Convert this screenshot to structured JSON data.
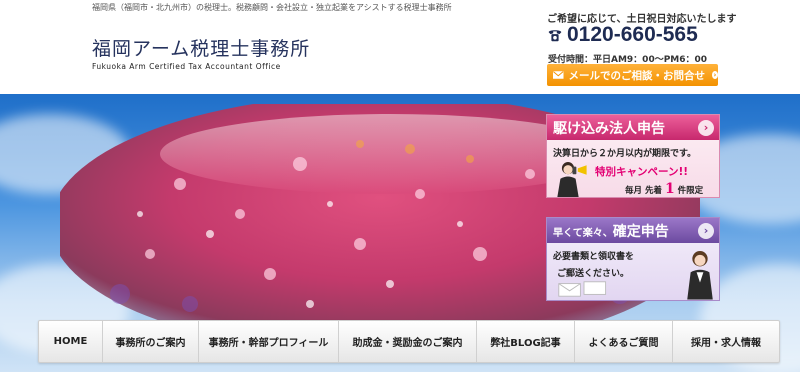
{
  "header": {
    "tagline": "福岡県（福岡市・北九州市）の税理士。税務顧問・会社設立・独立起業をアシストする税理士事務所",
    "logo_title": "福岡アーム税理士事務所",
    "logo_subtitle": "Fukuoka Arm Certified Tax Accountant Office",
    "notice": "ご希望に応じて、土日祝日対応いたします",
    "phone": "0120-660-565",
    "hours": "受付時間：平日AM9：00〜PM6：00",
    "mail_button": "メールでのご相談・お問合せ"
  },
  "promo1": {
    "title": "駆け込み法人申告",
    "line1": "決算日から２か月以内が期限です。",
    "campaign": "特別キャンペーン!!",
    "limit_prefix": "毎月 先着",
    "limit_number": "1",
    "limit_suffix": "件限定"
  },
  "promo2": {
    "title_prefix": "早くて楽々、",
    "title_main": "確定申告",
    "line1": "必要書類と領収書を",
    "line2": "ご郵送ください。"
  },
  "nav": {
    "items": [
      "HOME",
      "事務所のご案内",
      "事務所・幹部プロフィール",
      "助成金・奨励金のご案内",
      "弊社BLOG記事",
      "よくあるご質問",
      "採用・求人情報"
    ]
  },
  "colors": {
    "accent_orange": "#f39200",
    "promo_pink": "#c7286d",
    "promo_purple": "#6c4aa0",
    "navy": "#1e2b52"
  },
  "icons": {
    "phone": "phone-icon",
    "mail": "mail-icon",
    "chevron": "chevron-right-icon"
  }
}
